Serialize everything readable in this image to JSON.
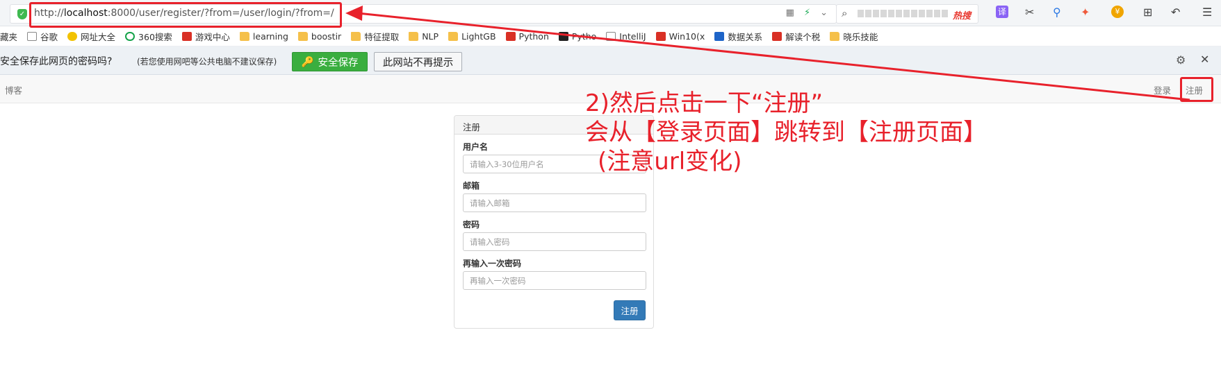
{
  "browser": {
    "url_prefix": "http://",
    "url_host": "localhost",
    "url_rest": ":8000/user/register/?from=/user/login/?from=/",
    "search_hot_label": "热搜",
    "translate_icon_label": "译",
    "wallet_icon_label": "¥"
  },
  "bookmarks": [
    {
      "label": "藏夹",
      "icon": "none"
    },
    {
      "label": "谷歌",
      "icon": "doc"
    },
    {
      "label": "网址大全",
      "icon": "yellow-circle"
    },
    {
      "label": "360搜索",
      "icon": "green-circle"
    },
    {
      "label": "游戏中心",
      "icon": "red-square"
    },
    {
      "label": "learning",
      "icon": "folder"
    },
    {
      "label": "boostir",
      "icon": "folder"
    },
    {
      "label": "特征提取",
      "icon": "folder"
    },
    {
      "label": "NLP",
      "icon": "folder"
    },
    {
      "label": "LightGB",
      "icon": "folder"
    },
    {
      "label": "Python",
      "icon": "red-square"
    },
    {
      "label": "Pytho",
      "icon": "black-square"
    },
    {
      "label": "IntelliJ",
      "icon": "doc"
    },
    {
      "label": "Win10(x",
      "icon": "red-square"
    },
    {
      "label": "数据关系",
      "icon": "blue-square"
    },
    {
      "label": "解读个税",
      "icon": "red-square"
    },
    {
      "label": "晓乐技能",
      "icon": "folder"
    }
  ],
  "password_bar": {
    "question": "安全保存此网页的密码吗?",
    "note": "(若您使用网吧等公共电脑不建议保存)",
    "save_label": "安全保存",
    "never_label": "此网站不再提示"
  },
  "site_nav": {
    "brand": "博客",
    "login": "登录",
    "register": "注册"
  },
  "register_form": {
    "title": "注册",
    "fields": [
      {
        "label": "用户名",
        "placeholder": "请输入3-30位用户名"
      },
      {
        "label": "邮箱",
        "placeholder": "请输入邮箱"
      },
      {
        "label": "密码",
        "placeholder": "请输入密码"
      },
      {
        "label": "再输入一次密码",
        "placeholder": "再输入一次密码"
      }
    ],
    "submit_label": "注册"
  },
  "annotation": {
    "line1": "2)然后点击一下“注册”",
    "line2": "会从【登录页面】跳转到【注册页面】",
    "line3": "(注意url变化)",
    "color": "#e8212b"
  }
}
